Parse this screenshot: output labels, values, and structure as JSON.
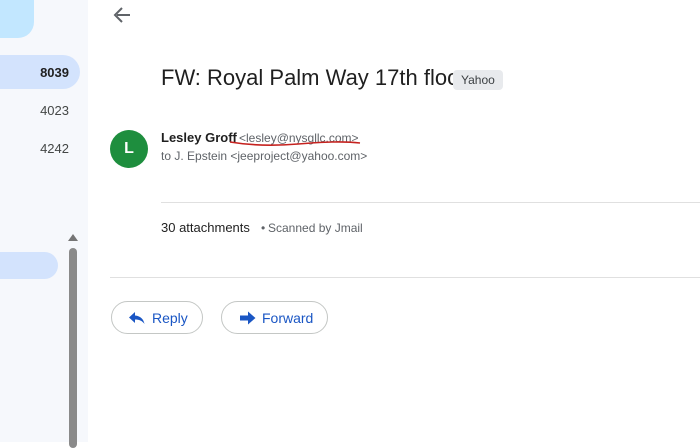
{
  "nav": {
    "counts": [
      "8039",
      "4023",
      "4242"
    ]
  },
  "message": {
    "subject": "FW: Royal Palm Way 17th floor",
    "label": "Yahoo",
    "sender": {
      "initial": "L",
      "name": "Lesley Groff",
      "email": "<lesley@nysgllc.com>",
      "avatar_color": "#1e8e3e"
    },
    "recipient_line": "to J. Epstein <jeeproject@yahoo.com>",
    "attachments": {
      "count_label": "30 attachments",
      "separator": "•",
      "scan_note": "Scanned by Jmail"
    }
  },
  "actions": {
    "reply_label": "Reply",
    "forward_label": "Forward"
  },
  "colors": {
    "accent": "#1a56c4",
    "nav_active": "#d3e3fd",
    "annotation_underline": "#c5221f"
  },
  "icons": {
    "back": "arrow-left-icon",
    "reply": "reply-arrow-icon",
    "forward": "forward-arrow-icon"
  }
}
